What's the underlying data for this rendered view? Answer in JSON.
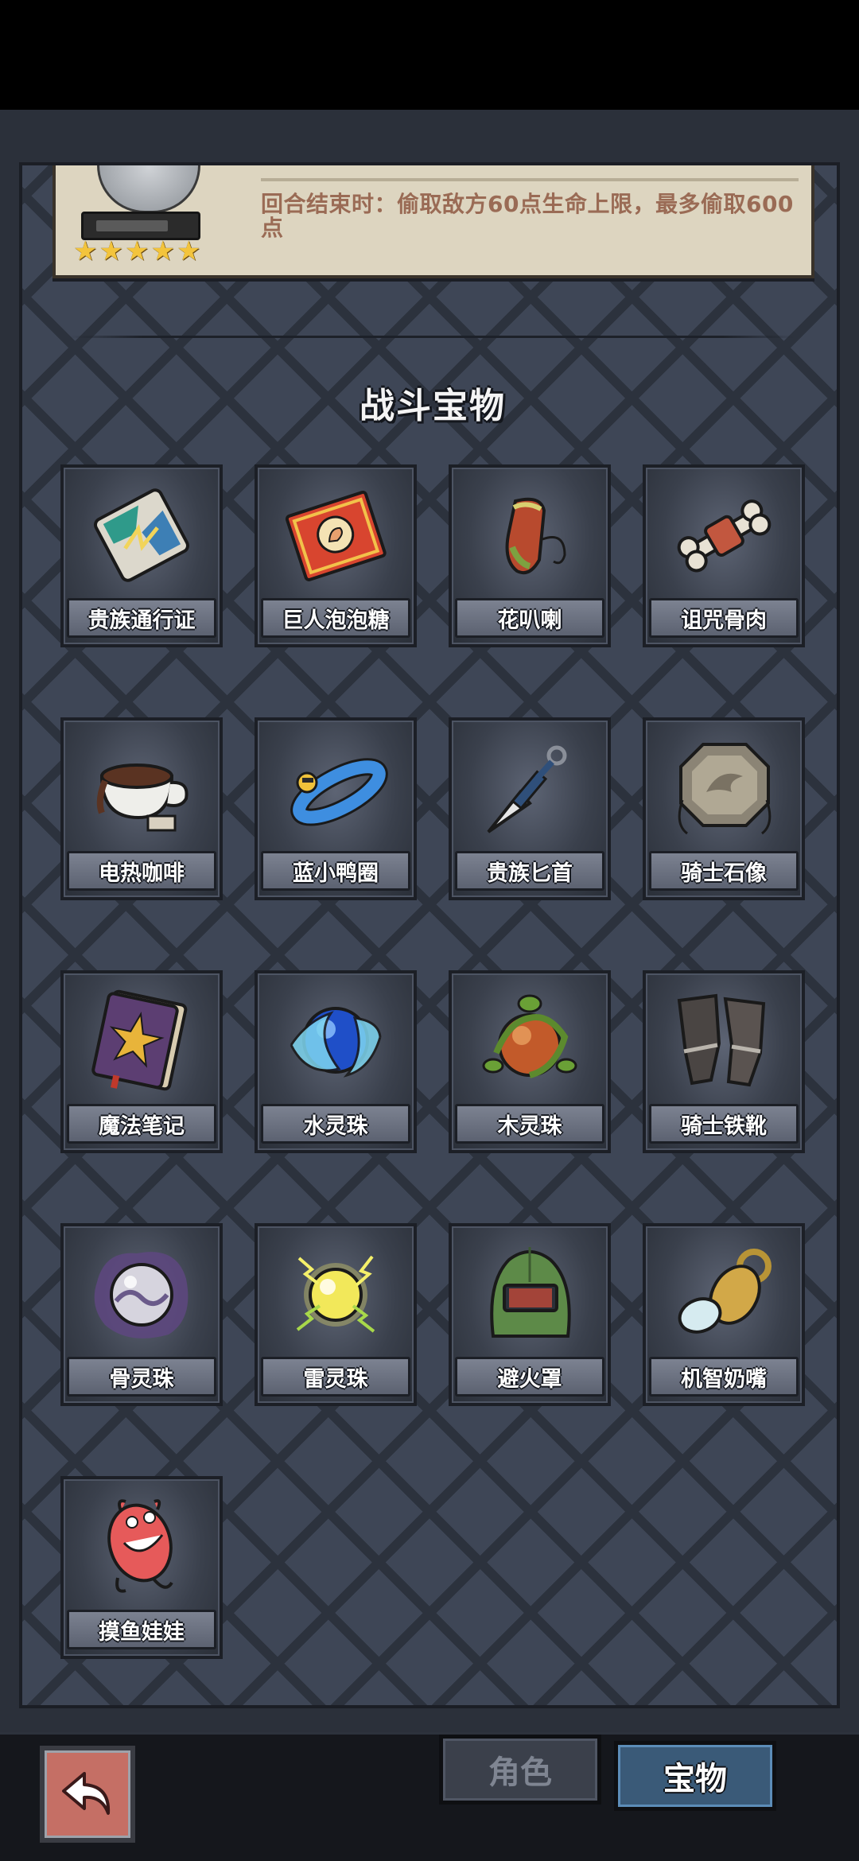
{
  "info_card": {
    "description": "回合结束时：偷取敌方60点生命上限，最多偷取600点",
    "stars": 5
  },
  "section": {
    "title": "战斗宝物"
  },
  "treasures": [
    {
      "name": "贵族通行证",
      "icon": "noble-pass-card-icon"
    },
    {
      "name": "巨人泡泡糖",
      "icon": "giant-bubblegum-box-icon"
    },
    {
      "name": "花叭喇",
      "icon": "pitcher-plant-icon"
    },
    {
      "name": "诅咒骨肉",
      "icon": "cursed-bone-meat-icon"
    },
    {
      "name": "电热咖啡",
      "icon": "electric-coffee-cup-icon"
    },
    {
      "name": "蓝小鸭圈",
      "icon": "blue-duck-float-ring-icon"
    },
    {
      "name": "贵族匕首",
      "icon": "noble-dagger-icon"
    },
    {
      "name": "骑士石像",
      "icon": "knight-stone-plate-icon"
    },
    {
      "name": "魔法笔记",
      "icon": "magic-notebook-icon"
    },
    {
      "name": "水灵珠",
      "icon": "water-orb-icon"
    },
    {
      "name": "木灵珠",
      "icon": "wood-orb-icon"
    },
    {
      "name": "骑士铁靴",
      "icon": "knight-iron-boots-icon"
    },
    {
      "name": "骨灵珠",
      "icon": "bone-orb-icon"
    },
    {
      "name": "雷灵珠",
      "icon": "thunder-orb-icon"
    },
    {
      "name": "避火罩",
      "icon": "fire-shield-helmet-icon"
    },
    {
      "name": "机智奶嘴",
      "icon": "pacifier-icon"
    },
    {
      "name": "摸鱼娃娃",
      "icon": "pink-monster-doll-icon"
    }
  ],
  "bottom_bar": {
    "tab_role": "角色",
    "tab_treasure": "宝物",
    "active_tab": "宝物"
  },
  "colors": {
    "panel": "#3e4656",
    "card_label": "#6b7180",
    "active_tab": "#3a5a78",
    "back_button": "#c56f65",
    "info_text": "#9a6b55"
  }
}
